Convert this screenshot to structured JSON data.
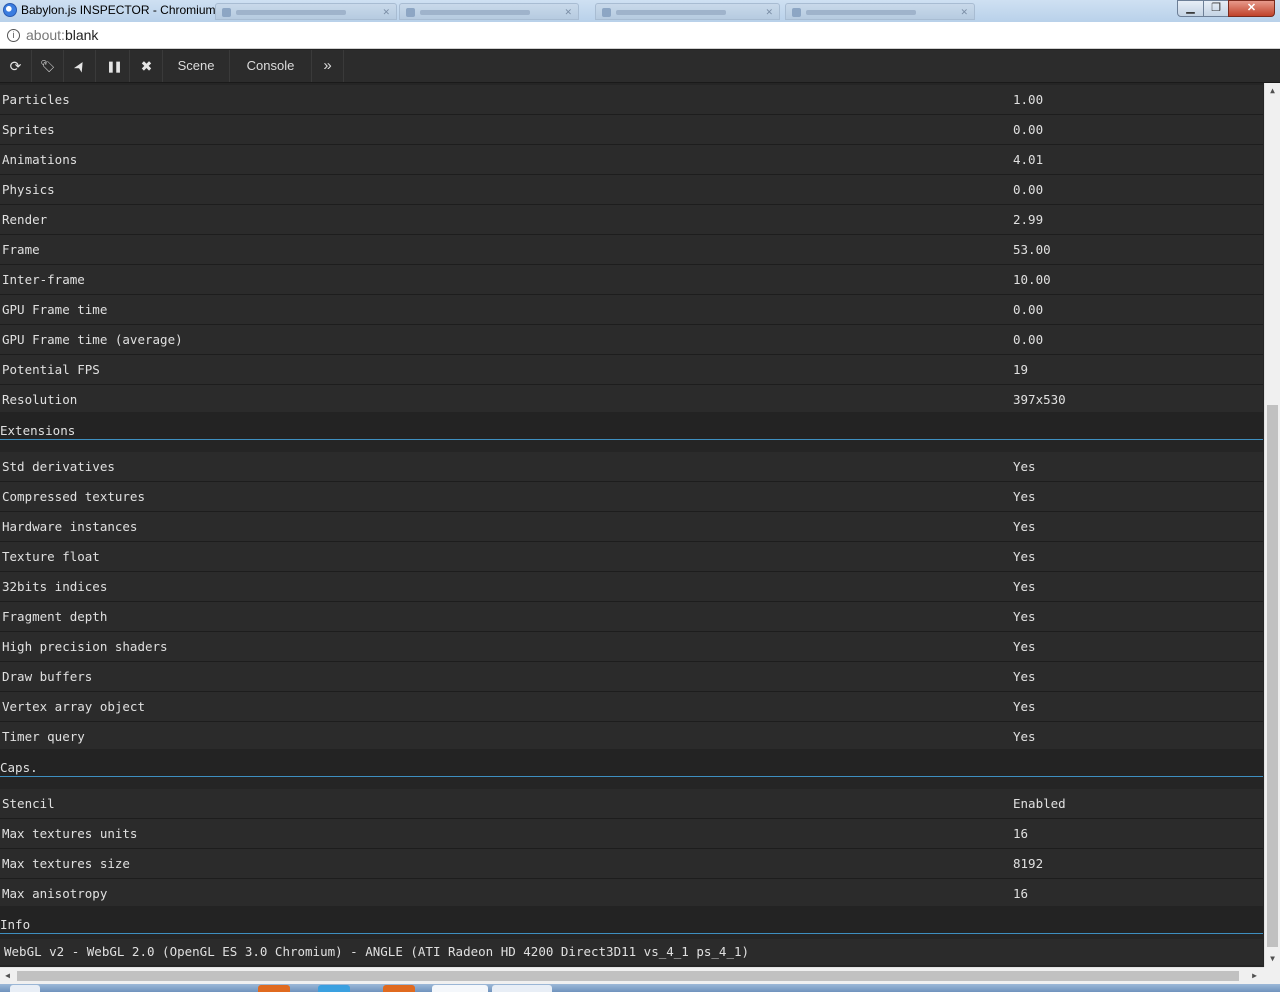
{
  "window": {
    "title": "Babylon.js INSPECTOR - Chromium",
    "controls": {
      "minimize": "▁",
      "maximize": "❐",
      "close": "✕"
    }
  },
  "address": {
    "scheme": "about:",
    "rest": "blank"
  },
  "toolbar": {
    "tools": [
      {
        "name": "refresh-icon",
        "glyph": "⟳"
      },
      {
        "name": "tags-icon",
        "glyph": "🏷"
      },
      {
        "name": "pointer-icon",
        "glyph": "➤"
      },
      {
        "name": "pause-icon",
        "glyph": "❚❚"
      },
      {
        "name": "close-icon",
        "glyph": "✖"
      }
    ],
    "tabs": {
      "scene": "Scene",
      "console": "Console",
      "more": "»"
    }
  },
  "stats": [
    {
      "label": "Particles",
      "value": "1.00"
    },
    {
      "label": "Sprites",
      "value": "0.00"
    },
    {
      "label": "Animations",
      "value": "4.01"
    },
    {
      "label": "Physics",
      "value": "0.00"
    },
    {
      "label": "Render",
      "value": "2.99"
    },
    {
      "label": "Frame",
      "value": "53.00"
    },
    {
      "label": "Inter-frame",
      "value": "10.00"
    },
    {
      "label": "GPU Frame time",
      "value": "0.00"
    },
    {
      "label": "GPU Frame time (average)",
      "value": "0.00"
    },
    {
      "label": "Potential FPS",
      "value": "19"
    },
    {
      "label": "Resolution",
      "value": "397x530"
    }
  ],
  "extensions": {
    "title": "Extensions",
    "rows": [
      {
        "label": "Std derivatives",
        "value": "Yes"
      },
      {
        "label": "Compressed textures",
        "value": "Yes"
      },
      {
        "label": "Hardware instances",
        "value": "Yes"
      },
      {
        "label": "Texture float",
        "value": "Yes"
      },
      {
        "label": "32bits indices",
        "value": "Yes"
      },
      {
        "label": "Fragment depth",
        "value": "Yes"
      },
      {
        "label": "High precision shaders",
        "value": "Yes"
      },
      {
        "label": "Draw buffers",
        "value": "Yes"
      },
      {
        "label": "Vertex array object",
        "value": "Yes"
      },
      {
        "label": "Timer query",
        "value": "Yes"
      }
    ]
  },
  "caps": {
    "title": "Caps.",
    "rows": [
      {
        "label": "Stencil",
        "value": "Enabled"
      },
      {
        "label": "Max textures units",
        "value": "16"
      },
      {
        "label": "Max textures size",
        "value": "8192"
      },
      {
        "label": "Max anisotropy",
        "value": "16"
      }
    ]
  },
  "info": {
    "title": "Info",
    "text": "WebGL v2 - WebGL 2.0 (OpenGL ES 3.0 Chromium) - ANGLE (ATI Radeon HD 4200 Direct3D11 vs_4_1 ps_4_1)"
  },
  "scrollbars": {
    "up": "▲",
    "down": "▼",
    "left": "◀",
    "right": "▶"
  },
  "colors": {
    "section_rule": "#3e8fc0",
    "row_bg": "#2b2b2b",
    "text": "#e0e0e0"
  }
}
